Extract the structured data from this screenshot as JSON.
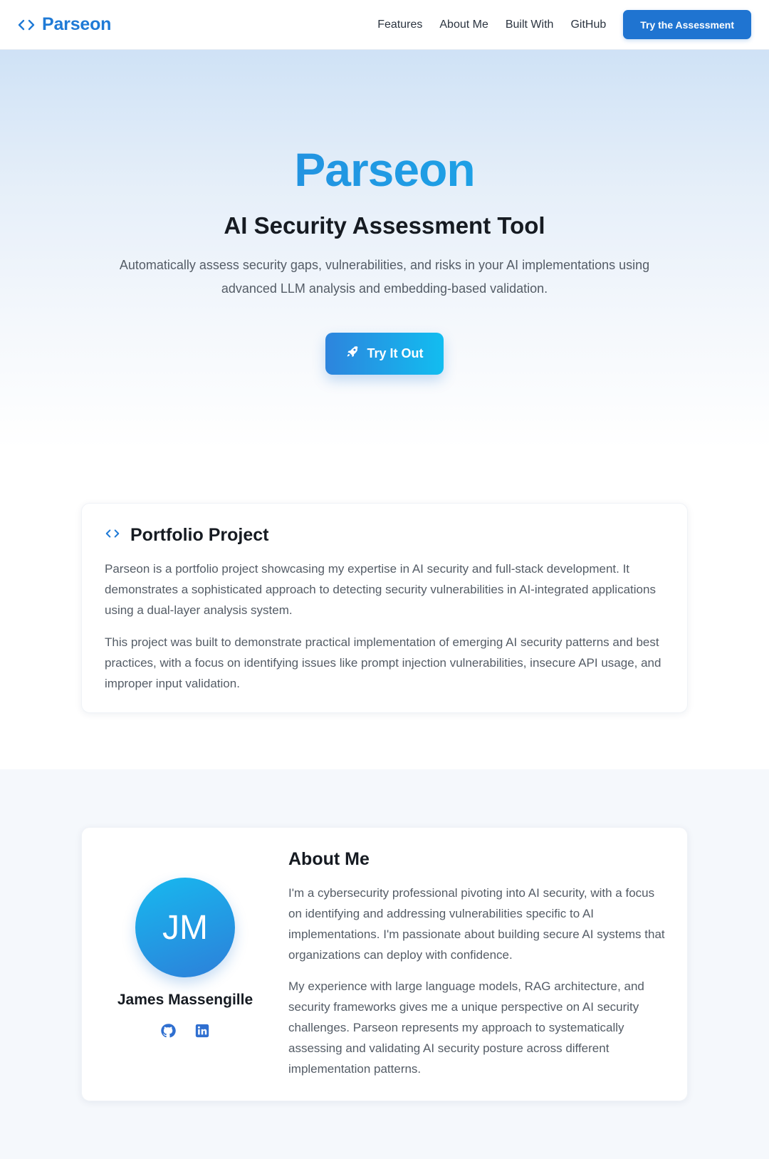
{
  "nav": {
    "brand": "Parseon",
    "links": [
      "Features",
      "About Me",
      "Built With",
      "GitHub"
    ],
    "cta": "Try the Assessment"
  },
  "hero": {
    "title": "Parseon",
    "subtitle": "AI Security Assessment Tool",
    "description": "Automatically assess security gaps, vulnerabilities, and risks in your AI implementations using advanced LLM analysis and embedding-based validation.",
    "button": "Try It Out"
  },
  "portfolio": {
    "title": "Portfolio Project",
    "paragraphs": [
      "Parseon is a portfolio project showcasing my expertise in AI security and full-stack development. It demonstrates a sophisticated approach to detecting security vulnerabilities in AI-integrated applications using a dual-layer analysis system.",
      "This project was built to demonstrate practical implementation of emerging AI security patterns and best practices, with a focus on identifying issues like prompt injection vulnerabilities, insecure API usage, and improper input validation."
    ]
  },
  "about": {
    "title": "About Me",
    "initials": "JM",
    "name": "James Massengille",
    "paragraphs": [
      "I'm a cybersecurity professional pivoting into AI security, with a focus on identifying and addressing vulnerabilities specific to AI implementations. I'm passionate about building secure AI systems that organizations can deploy with confidence.",
      "My experience with large language models, RAG architecture, and security frameworks gives me a unique perspective on AI security challenges. Parseon represents my approach to systematically assessing and validating AI security posture across different implementation patterns."
    ],
    "socials": [
      "github-icon",
      "linkedin-icon"
    ]
  },
  "colors": {
    "brand_blue": "#1f7ad6",
    "cta_blue": "#1f74d1",
    "gradient_cyan": "#12bdf0"
  }
}
